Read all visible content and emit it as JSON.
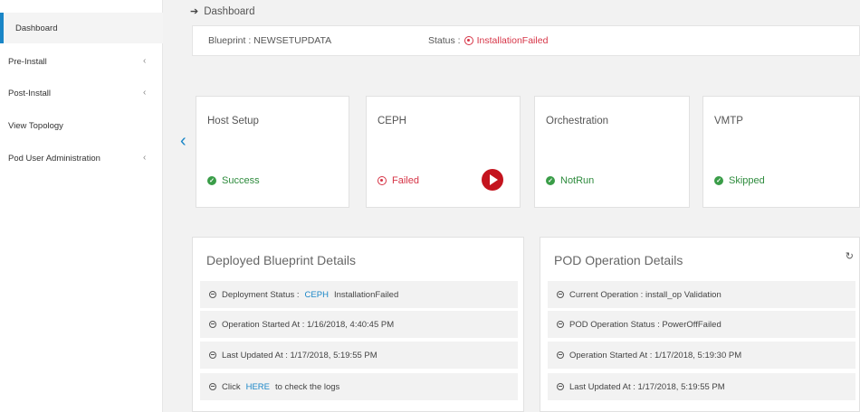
{
  "sidebar": {
    "items": [
      {
        "label": "Dashboard",
        "chevron": ""
      },
      {
        "label": "Pre-Install",
        "chevron": "‹"
      },
      {
        "label": "Post-Install",
        "chevron": "‹"
      },
      {
        "label": "View Topology",
        "chevron": ""
      },
      {
        "label": "Pod User Administration",
        "chevron": "‹"
      }
    ]
  },
  "breadcrumb": {
    "arrow": "➔",
    "label": "Dashboard"
  },
  "blueprint": {
    "name_label": "Blueprint : NEWSETUPDATA",
    "status_label": "Status :",
    "status_value": "InstallationFailed"
  },
  "collapse_glyph": "‹",
  "steps": [
    {
      "title": "Host Setup",
      "status": "Success",
      "state": "ok"
    },
    {
      "title": "CEPH",
      "status": "Failed",
      "state": "failed"
    },
    {
      "title": "Orchestration",
      "status": "NotRun",
      "state": "ok"
    },
    {
      "title": "VMTP",
      "status": "Skipped",
      "state": "ok"
    }
  ],
  "deployed_panel": {
    "title": "Deployed Blueprint Details",
    "row1": {
      "prefix": "Deployment Status :",
      "link": "CEPH",
      "suffix": "InstallationFailed"
    },
    "row2": "Operation Started At : 1/16/2018, 4:40:45 PM",
    "row3": "Last Updated At : 1/17/2018, 5:19:55 PM",
    "row4": {
      "prefix": "Click",
      "link": "HERE",
      "suffix": "to check the logs"
    }
  },
  "pod_panel": {
    "title": "POD Operation Details",
    "refresh_glyph": "↻",
    "rows": [
      "Current Operation : install_op Validation",
      "POD Operation Status : PowerOffFailed",
      "Operation Started At : 1/17/2018, 5:19:30 PM",
      "Last Updated At : 1/17/2018, 5:19:55 PM"
    ]
  },
  "colors": {
    "accent": "#1a86c7",
    "success": "#3a9d48",
    "failure": "#d63446",
    "play": "#c4141e"
  }
}
